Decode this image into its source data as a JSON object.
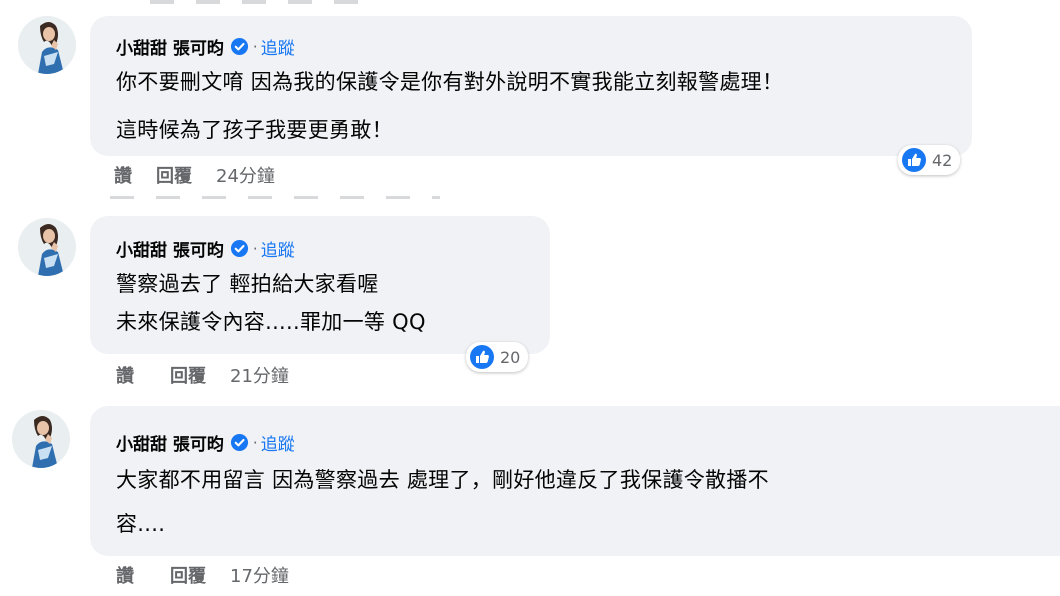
{
  "colors": {
    "link": "#1877f2",
    "bubble": "#f0f2f5",
    "muted": "#65676b",
    "like": "#1877f2"
  },
  "comments": [
    {
      "author": "小甜甜 張可昀",
      "separator": "·",
      "follow_label": "追蹤",
      "lines": [
        "你不要刪文唷 因為我的保護令是你有對外說明不實我能立刻報警處理！",
        "這時候為了孩子我要更勇敢！"
      ],
      "like_label": "讚",
      "reply_label": "回覆",
      "time": "24分鐘",
      "reaction_count": "42"
    },
    {
      "author": "小甜甜 張可昀",
      "separator": "·",
      "follow_label": "追蹤",
      "lines": [
        "警察過去了 輕拍給大家看喔",
        "未來保護令內容.....罪加一等 QQ"
      ],
      "like_label": "讚",
      "reply_label": "回覆",
      "time": "21分鐘",
      "reaction_count": "20"
    },
    {
      "author": "小甜甜 張可昀",
      "separator": "·",
      "follow_label": "追蹤",
      "lines": [
        "大家都不用留言 因為警察過去 處理了，剛好他違反了我保護令散播不",
        "容...."
      ],
      "like_label": "讚",
      "reply_label": "回覆",
      "time": "17分鐘"
    }
  ]
}
